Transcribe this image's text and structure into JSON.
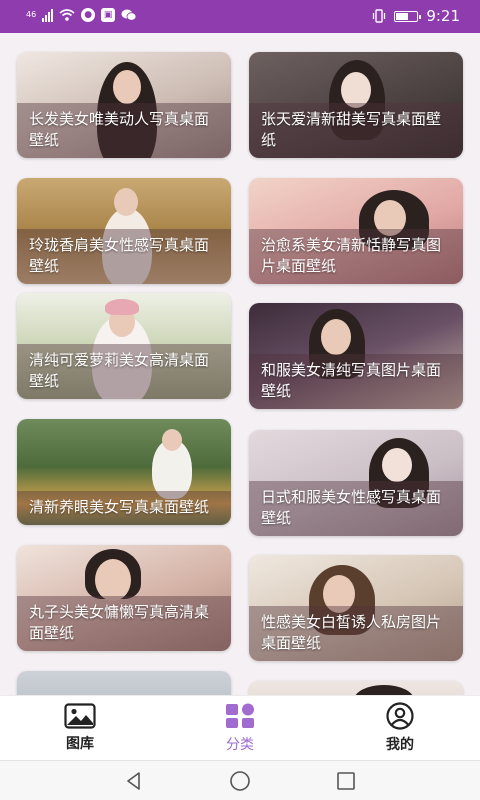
{
  "status_bar": {
    "network_label": "46",
    "time": "9:21",
    "battery_level": 0.65,
    "icons": [
      "signal-icon",
      "wifi-icon",
      "notification-icon",
      "app-icon",
      "wechat-icon",
      "vibrate-icon",
      "battery-icon"
    ]
  },
  "cards": [
    {
      "title": "长发美女唯美动人写真桌面壁纸",
      "bg": "#d7c9c0"
    },
    {
      "title": "张天爱清新甜美写真桌面壁纸",
      "bg": "#5a4f4e"
    },
    {
      "title": "玲珑香肩美女性感写真桌面壁纸",
      "bg": "#b99660"
    },
    {
      "title": "治愈系美女清新恬静写真图片桌面壁纸",
      "bg": "#e5b9b3"
    },
    {
      "title": "清纯可爱萝莉美女高清桌面壁纸",
      "bg": "#c6d2b0"
    },
    {
      "title": "和服美女清纯写真图片桌面壁纸",
      "bg": "#4f3e4e"
    },
    {
      "title": "清新养眼美女写真桌面壁纸",
      "bg": "#5f7c4a"
    },
    {
      "title": "日式和服美女性感写真桌面壁纸",
      "bg": "#d8cfd4"
    },
    {
      "title": "丸子头美女慵懒写真高清桌面壁纸",
      "bg": "#d7b6a9"
    },
    {
      "title": "性感美女白皙诱人私房图片桌面壁纸",
      "bg": "#d8ccc0"
    }
  ],
  "bottom_nav": {
    "accent_color": "#a26bd0",
    "items": [
      {
        "label": "图库",
        "icon": "gallery-icon",
        "active": false
      },
      {
        "label": "分类",
        "icon": "category-icon",
        "active": true
      },
      {
        "label": "我的",
        "icon": "profile-icon",
        "active": false
      }
    ]
  },
  "system_nav": [
    "back-button",
    "home-button",
    "recents-button"
  ]
}
